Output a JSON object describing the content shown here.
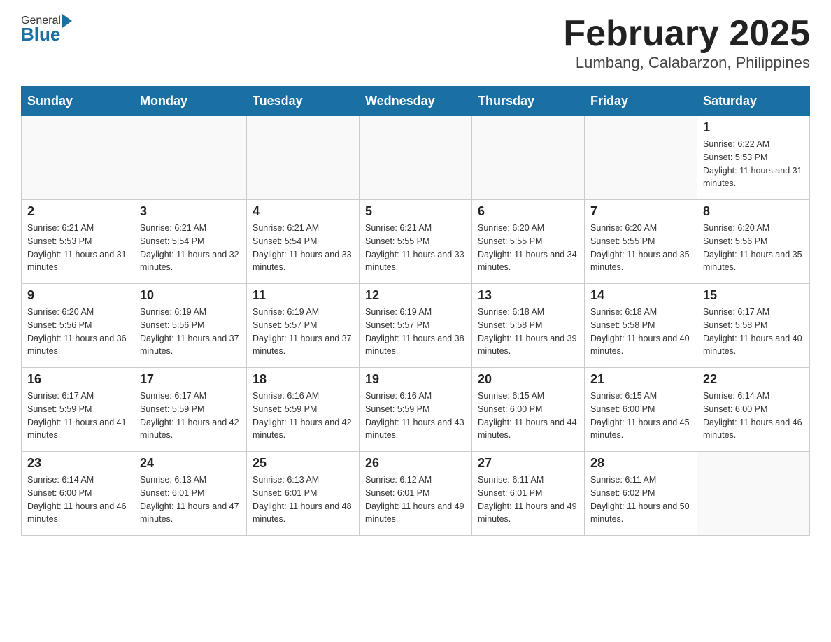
{
  "header": {
    "logo_text_general": "General",
    "logo_text_blue": "Blue",
    "title": "February 2025",
    "subtitle": "Lumbang, Calabarzon, Philippines"
  },
  "weekdays": [
    "Sunday",
    "Monday",
    "Tuesday",
    "Wednesday",
    "Thursday",
    "Friday",
    "Saturday"
  ],
  "weeks": [
    [
      {
        "day": "",
        "sunrise": "",
        "sunset": "",
        "daylight": ""
      },
      {
        "day": "",
        "sunrise": "",
        "sunset": "",
        "daylight": ""
      },
      {
        "day": "",
        "sunrise": "",
        "sunset": "",
        "daylight": ""
      },
      {
        "day": "",
        "sunrise": "",
        "sunset": "",
        "daylight": ""
      },
      {
        "day": "",
        "sunrise": "",
        "sunset": "",
        "daylight": ""
      },
      {
        "day": "",
        "sunrise": "",
        "sunset": "",
        "daylight": ""
      },
      {
        "day": "1",
        "sunrise": "Sunrise: 6:22 AM",
        "sunset": "Sunset: 5:53 PM",
        "daylight": "Daylight: 11 hours and 31 minutes."
      }
    ],
    [
      {
        "day": "2",
        "sunrise": "Sunrise: 6:21 AM",
        "sunset": "Sunset: 5:53 PM",
        "daylight": "Daylight: 11 hours and 31 minutes."
      },
      {
        "day": "3",
        "sunrise": "Sunrise: 6:21 AM",
        "sunset": "Sunset: 5:54 PM",
        "daylight": "Daylight: 11 hours and 32 minutes."
      },
      {
        "day": "4",
        "sunrise": "Sunrise: 6:21 AM",
        "sunset": "Sunset: 5:54 PM",
        "daylight": "Daylight: 11 hours and 33 minutes."
      },
      {
        "day": "5",
        "sunrise": "Sunrise: 6:21 AM",
        "sunset": "Sunset: 5:55 PM",
        "daylight": "Daylight: 11 hours and 33 minutes."
      },
      {
        "day": "6",
        "sunrise": "Sunrise: 6:20 AM",
        "sunset": "Sunset: 5:55 PM",
        "daylight": "Daylight: 11 hours and 34 minutes."
      },
      {
        "day": "7",
        "sunrise": "Sunrise: 6:20 AM",
        "sunset": "Sunset: 5:55 PM",
        "daylight": "Daylight: 11 hours and 35 minutes."
      },
      {
        "day": "8",
        "sunrise": "Sunrise: 6:20 AM",
        "sunset": "Sunset: 5:56 PM",
        "daylight": "Daylight: 11 hours and 35 minutes."
      }
    ],
    [
      {
        "day": "9",
        "sunrise": "Sunrise: 6:20 AM",
        "sunset": "Sunset: 5:56 PM",
        "daylight": "Daylight: 11 hours and 36 minutes."
      },
      {
        "day": "10",
        "sunrise": "Sunrise: 6:19 AM",
        "sunset": "Sunset: 5:56 PM",
        "daylight": "Daylight: 11 hours and 37 minutes."
      },
      {
        "day": "11",
        "sunrise": "Sunrise: 6:19 AM",
        "sunset": "Sunset: 5:57 PM",
        "daylight": "Daylight: 11 hours and 37 minutes."
      },
      {
        "day": "12",
        "sunrise": "Sunrise: 6:19 AM",
        "sunset": "Sunset: 5:57 PM",
        "daylight": "Daylight: 11 hours and 38 minutes."
      },
      {
        "day": "13",
        "sunrise": "Sunrise: 6:18 AM",
        "sunset": "Sunset: 5:58 PM",
        "daylight": "Daylight: 11 hours and 39 minutes."
      },
      {
        "day": "14",
        "sunrise": "Sunrise: 6:18 AM",
        "sunset": "Sunset: 5:58 PM",
        "daylight": "Daylight: 11 hours and 40 minutes."
      },
      {
        "day": "15",
        "sunrise": "Sunrise: 6:17 AM",
        "sunset": "Sunset: 5:58 PM",
        "daylight": "Daylight: 11 hours and 40 minutes."
      }
    ],
    [
      {
        "day": "16",
        "sunrise": "Sunrise: 6:17 AM",
        "sunset": "Sunset: 5:59 PM",
        "daylight": "Daylight: 11 hours and 41 minutes."
      },
      {
        "day": "17",
        "sunrise": "Sunrise: 6:17 AM",
        "sunset": "Sunset: 5:59 PM",
        "daylight": "Daylight: 11 hours and 42 minutes."
      },
      {
        "day": "18",
        "sunrise": "Sunrise: 6:16 AM",
        "sunset": "Sunset: 5:59 PM",
        "daylight": "Daylight: 11 hours and 42 minutes."
      },
      {
        "day": "19",
        "sunrise": "Sunrise: 6:16 AM",
        "sunset": "Sunset: 5:59 PM",
        "daylight": "Daylight: 11 hours and 43 minutes."
      },
      {
        "day": "20",
        "sunrise": "Sunrise: 6:15 AM",
        "sunset": "Sunset: 6:00 PM",
        "daylight": "Daylight: 11 hours and 44 minutes."
      },
      {
        "day": "21",
        "sunrise": "Sunrise: 6:15 AM",
        "sunset": "Sunset: 6:00 PM",
        "daylight": "Daylight: 11 hours and 45 minutes."
      },
      {
        "day": "22",
        "sunrise": "Sunrise: 6:14 AM",
        "sunset": "Sunset: 6:00 PM",
        "daylight": "Daylight: 11 hours and 46 minutes."
      }
    ],
    [
      {
        "day": "23",
        "sunrise": "Sunrise: 6:14 AM",
        "sunset": "Sunset: 6:00 PM",
        "daylight": "Daylight: 11 hours and 46 minutes."
      },
      {
        "day": "24",
        "sunrise": "Sunrise: 6:13 AM",
        "sunset": "Sunset: 6:01 PM",
        "daylight": "Daylight: 11 hours and 47 minutes."
      },
      {
        "day": "25",
        "sunrise": "Sunrise: 6:13 AM",
        "sunset": "Sunset: 6:01 PM",
        "daylight": "Daylight: 11 hours and 48 minutes."
      },
      {
        "day": "26",
        "sunrise": "Sunrise: 6:12 AM",
        "sunset": "Sunset: 6:01 PM",
        "daylight": "Daylight: 11 hours and 49 minutes."
      },
      {
        "day": "27",
        "sunrise": "Sunrise: 6:11 AM",
        "sunset": "Sunset: 6:01 PM",
        "daylight": "Daylight: 11 hours and 49 minutes."
      },
      {
        "day": "28",
        "sunrise": "Sunrise: 6:11 AM",
        "sunset": "Sunset: 6:02 PM",
        "daylight": "Daylight: 11 hours and 50 minutes."
      },
      {
        "day": "",
        "sunrise": "",
        "sunset": "",
        "daylight": ""
      }
    ]
  ]
}
